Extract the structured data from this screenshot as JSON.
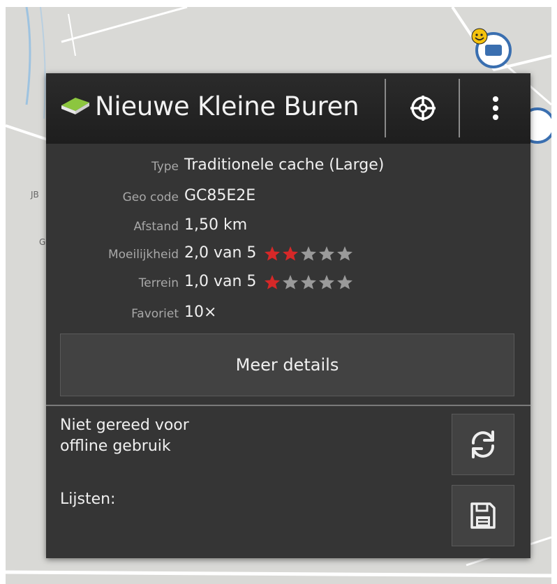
{
  "popup": {
    "title": "Nieuwe Kleine Buren",
    "cache_icon": "green-cache-icon",
    "actions": [
      {
        "name": "target-icon"
      },
      {
        "name": "more-vertical-icon"
      }
    ],
    "info_rows": [
      {
        "label": "Type",
        "value": "Traditionele cache (Large)"
      },
      {
        "label": "Geo code",
        "value": "GC85E2E"
      },
      {
        "label": "Afstand",
        "value": "1,50 km"
      },
      {
        "label": "Moeilijkheid",
        "value": "2,0 van 5",
        "rating": 2,
        "rating_max": 5
      },
      {
        "label": "Terrein",
        "value": "1,0 van 5",
        "rating": 1,
        "rating_max": 5
      },
      {
        "label": "Favoriet",
        "value": "10×"
      }
    ],
    "details_button": "Meer details",
    "offline_status": "Niet gereed voor\n offline gebruik",
    "lists_label": "Lijsten:",
    "refresh_icon": "refresh-icon",
    "save_icon": "save-floppy-icon"
  },
  "colors": {
    "star_filled": "#d62828",
    "star_empty": "#9a9a9a",
    "popup_bg": "#353535",
    "accent_green": "#7cc242"
  }
}
